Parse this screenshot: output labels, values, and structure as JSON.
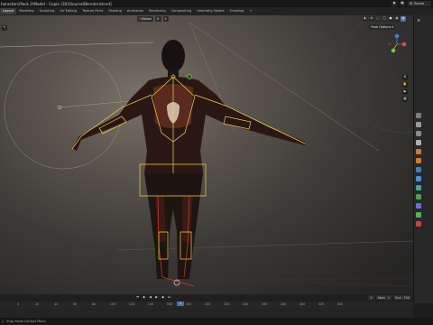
{
  "window": {
    "title": "haracters\\Pack 2\\Model - Copie (30)\\Source\\Blender.blend]"
  },
  "header": {
    "scene_label": "Scene",
    "icons": [
      "object-icon",
      "scene-icon"
    ]
  },
  "workspace_tabs": [
    {
      "label": "Layout",
      "active": true
    },
    {
      "label": "Modeling",
      "active": false
    },
    {
      "label": "Sculpting",
      "active": false
    },
    {
      "label": "UV Editing",
      "active": false
    },
    {
      "label": "Texture Paint",
      "active": false
    },
    {
      "label": "Shading",
      "active": false
    },
    {
      "label": "Animation",
      "active": false
    },
    {
      "label": "Rendering",
      "active": false
    },
    {
      "label": "Compositing",
      "active": false
    },
    {
      "label": "Geometry Nodes",
      "active": false
    },
    {
      "label": "Scripting",
      "active": false
    },
    {
      "label": "+",
      "active": false
    }
  ],
  "viewport": {
    "orientation_label": "Global",
    "pose_options_label": "Pose Options",
    "gizmo_axes": {
      "x": "X",
      "y": "Y",
      "z": "Z"
    },
    "colors": {
      "x_axis": "#e04a4a",
      "y_axis": "#7ac24a",
      "z_axis": "#4a7ae0",
      "bone_yellow": "#f0d040",
      "bone_red": "#d83a2a"
    }
  },
  "timeline": {
    "current_frame": "1",
    "start_label": "Start",
    "start_value": "1",
    "end_label": "End",
    "end_value": "250",
    "playhead_label": "1",
    "ticks": [
      "0",
      "20",
      "40",
      "60",
      "80",
      "100",
      "120",
      "140",
      "160",
      "180",
      "200",
      "220",
      "240",
      "260",
      "280",
      "300",
      "320",
      "340"
    ]
  },
  "status": {
    "text": "Snap Mode    Context Menu"
  }
}
